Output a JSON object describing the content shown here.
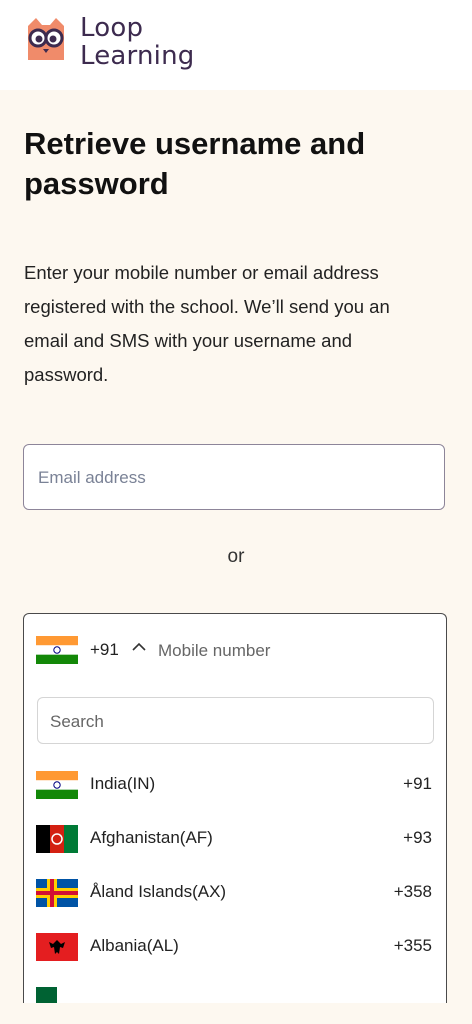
{
  "brand": {
    "line1": "Loop",
    "line2": "Learning"
  },
  "page": {
    "title": "Retrieve username and password",
    "description": "Enter your mobile number or email address registered with the school. We’ll send you an email and SMS with your username and password."
  },
  "email": {
    "placeholder": "Email address"
  },
  "separator": "or",
  "phone": {
    "selected_dial_code": "+91",
    "selected_flag": "india-flag-icon",
    "placeholder": "Mobile number",
    "search_placeholder": "Search",
    "countries": [
      {
        "name": "India(IN)",
        "code": "+91",
        "flag": "india-flag-icon"
      },
      {
        "name": "Afghanistan(AF)",
        "code": "+93",
        "flag": "afghanistan-flag-icon"
      },
      {
        "name": "Åland Islands(AX)",
        "code": "+358",
        "flag": "aland-islands-flag-icon"
      },
      {
        "name": "Albania(AL)",
        "code": "+355",
        "flag": "albania-flag-icon"
      }
    ]
  },
  "colors": {
    "background": "#fdf8f0",
    "brand_text": "#3d2b4f",
    "owl": "#f08b6a",
    "input_border": "#8d8599"
  }
}
